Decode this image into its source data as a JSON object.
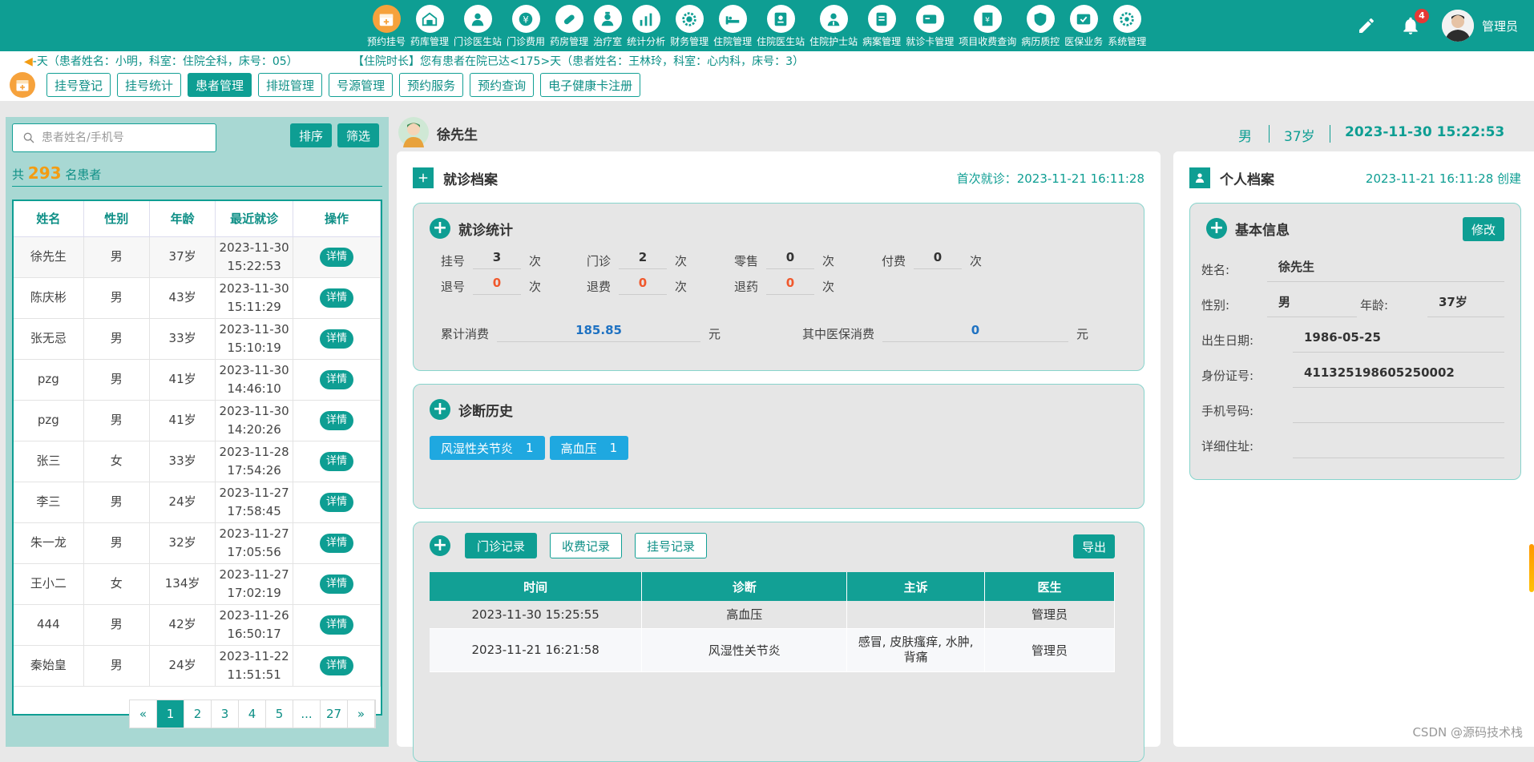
{
  "nav": [
    {
      "label": "预约挂号",
      "icon": "calendar-icon",
      "active": true
    },
    {
      "label": "药库管理",
      "icon": "warehouse-icon"
    },
    {
      "label": "门诊医生站",
      "icon": "doctor-icon"
    },
    {
      "label": "门诊费用",
      "icon": "yen-icon"
    },
    {
      "label": "药房管理",
      "icon": "pill-icon"
    },
    {
      "label": "治疗室",
      "icon": "nurse-icon"
    },
    {
      "label": "统计分析",
      "icon": "bar-chart-icon"
    },
    {
      "label": "财务管理",
      "icon": "gear-coin-icon"
    },
    {
      "label": "住院管理",
      "icon": "bed-icon"
    },
    {
      "label": "住院医生站",
      "icon": "doctor-badge-icon"
    },
    {
      "label": "住院护士站",
      "icon": "nurse-badge-icon"
    },
    {
      "label": "病案管理",
      "icon": "record-icon"
    },
    {
      "label": "就诊卡管理",
      "icon": "card-icon"
    },
    {
      "label": "项目收费查询",
      "icon": "receipt-icon"
    },
    {
      "label": "病历质控",
      "icon": "shield-icon"
    },
    {
      "label": "医保业务",
      "icon": "insurance-icon"
    },
    {
      "label": "系统管理",
      "icon": "settings-icon"
    }
  ],
  "user": {
    "name": "管理员",
    "notifications": "4"
  },
  "ticker": {
    "msg1": "天（患者姓名：小明，科室：住院全科，床号：05）",
    "msg1_prefix": "-",
    "msg2": "【住院时长】您有患者在院已达<175>天（患者姓名：王林玲，科室：心内科，床号：3）"
  },
  "subnav": [
    "挂号登记",
    "挂号统计",
    "患者管理",
    "排班管理",
    "号源管理",
    "预约服务",
    "预约查询",
    "电子健康卡注册"
  ],
  "subnav_active": 2,
  "left": {
    "search_placeholder": "患者姓名/手机号",
    "sort_label": "排序",
    "filter_label": "筛选",
    "count_prefix": "共",
    "count": "293",
    "count_suffix": "名患者",
    "headers": [
      "姓名",
      "性别",
      "年龄",
      "最近就诊",
      "操作"
    ],
    "detail_label": "详情",
    "rows": [
      {
        "name": "徐先生",
        "sex": "男",
        "age": "37岁",
        "date": "2023-11-30",
        "time": "15:22:53"
      },
      {
        "name": "陈庆彬",
        "sex": "男",
        "age": "43岁",
        "date": "2023-11-30",
        "time": "15:11:29"
      },
      {
        "name": "张无忌",
        "sex": "男",
        "age": "33岁",
        "date": "2023-11-30",
        "time": "15:10:19"
      },
      {
        "name": "pzg",
        "sex": "男",
        "age": "41岁",
        "date": "2023-11-30",
        "time": "14:46:10"
      },
      {
        "name": "pzg",
        "sex": "男",
        "age": "41岁",
        "date": "2023-11-30",
        "time": "14:20:26"
      },
      {
        "name": "张三",
        "sex": "女",
        "age": "33岁",
        "date": "2023-11-28",
        "time": "17:54:26"
      },
      {
        "name": "李三",
        "sex": "男",
        "age": "24岁",
        "date": "2023-11-27",
        "time": "17:58:45"
      },
      {
        "name": "朱一龙",
        "sex": "男",
        "age": "32岁",
        "date": "2023-11-27",
        "time": "17:05:56"
      },
      {
        "name": "王小二",
        "sex": "女",
        "age": "134岁",
        "date": "2023-11-27",
        "time": "17:02:19"
      },
      {
        "name": "444",
        "sex": "男",
        "age": "42岁",
        "date": "2023-11-26",
        "time": "16:50:17"
      },
      {
        "name": "秦始皇",
        "sex": "男",
        "age": "24岁",
        "date": "2023-11-22",
        "time": "11:51:51"
      }
    ],
    "pager": [
      "«",
      "1",
      "2",
      "3",
      "4",
      "5",
      "...",
      "27",
      "»"
    ],
    "pager_active": 1
  },
  "patient": {
    "name": "徐先生",
    "sex": "男",
    "age": "37岁",
    "visit_time": "2023-11-30 15:22:53"
  },
  "visit": {
    "title": "就诊档案",
    "first_visit_label": "首次就诊：",
    "first_visit": "2023-11-21 16:11:28",
    "stats_title": "就诊统计",
    "unit": "次",
    "stats": [
      {
        "label": "挂号",
        "value": "3"
      },
      {
        "label": "门诊",
        "value": "2"
      },
      {
        "label": "零售",
        "value": "0"
      },
      {
        "label": "付费",
        "value": "0"
      },
      {
        "label": "退号",
        "value": "0"
      },
      {
        "label": "退费",
        "value": "0"
      },
      {
        "label": "退药",
        "value": "0"
      }
    ],
    "total_label": "累计消费",
    "total": "185.85",
    "insurance_label": "其中医保消费",
    "insurance": "0",
    "currency": "元",
    "history_title": "诊断历史",
    "history": [
      {
        "name": "风湿性关节炎",
        "count": "1"
      },
      {
        "name": "高血压",
        "count": "1"
      }
    ],
    "record_tabs": [
      "门诊记录",
      "收费记录",
      "挂号记录"
    ],
    "export_label": "导出",
    "record_headers": [
      "时间",
      "诊断",
      "主诉",
      "医生"
    ],
    "records": [
      {
        "time": "2023-11-30 15:25:55",
        "diag": "高血压",
        "complaint": "",
        "doctor": "管理员"
      },
      {
        "time": "2023-11-21 16:21:58",
        "diag": "风湿性关节炎",
        "complaint": "感冒, 皮肤瘙痒, 水肿, 背痛",
        "doctor": "管理员"
      }
    ]
  },
  "personal": {
    "title": "个人档案",
    "created": "2023-11-21 16:11:28 创建",
    "basic_title": "基本信息",
    "edit_label": "修改",
    "name_label": "姓名:",
    "name": "徐先生",
    "sex_label": "性别:",
    "sex": "男",
    "age_label": "年龄:",
    "age": "37岁",
    "birth_label": "出生日期:",
    "birth": "1986-05-25",
    "id_label": "身份证号:",
    "id": "411325198605250002",
    "phone_label": "手机号码:",
    "phone": "",
    "addr_label": "详细住址:",
    "addr": ""
  },
  "watermark": "CSDN @源码技术栈",
  "colors": {
    "primary": "#0e9e93",
    "accent": "#f6a23c",
    "tag": "#1fa8e0",
    "danger": "#f0582c"
  }
}
